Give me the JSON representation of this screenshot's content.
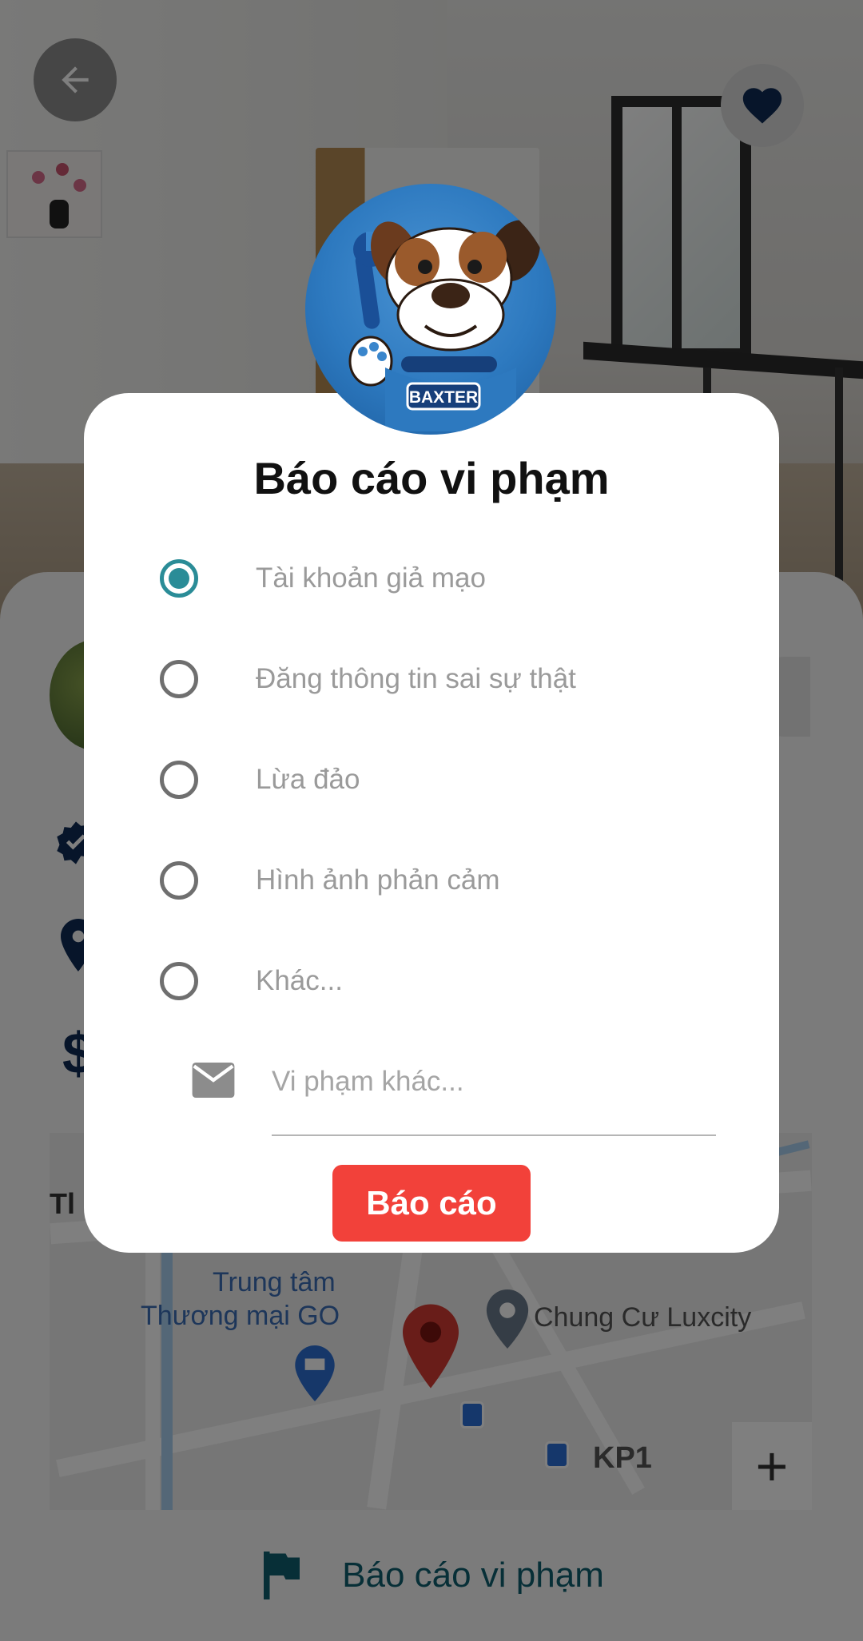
{
  "dialog": {
    "title": "Báo cáo vi phạm",
    "options": [
      {
        "label": "Tài khoản giả mạo",
        "checked": true
      },
      {
        "label": "Đăng thông tin sai sự thật",
        "checked": false
      },
      {
        "label": "Lừa đảo",
        "checked": false
      },
      {
        "label": "Hình ảnh phản cảm",
        "checked": false
      },
      {
        "label": "Khác...",
        "checked": false
      }
    ],
    "other_placeholder": "Vi phạm khác...",
    "other_value": "",
    "submit_label": "Báo cáo",
    "avatar_text": "BAXTER"
  },
  "map": {
    "labels": [
      "Trung tâm",
      "Thương mại GO",
      "Chung Cư Luxcity",
      "KP1"
    ],
    "zoom_in": "+",
    "side_text": "Tl"
  },
  "footer": {
    "report_label": "Báo cáo vi phạm"
  },
  "colors": {
    "accent": "#2a8c97",
    "danger": "#f2413a",
    "brand_dark": "#0e2a54",
    "report_text": "#0e5e6f"
  }
}
